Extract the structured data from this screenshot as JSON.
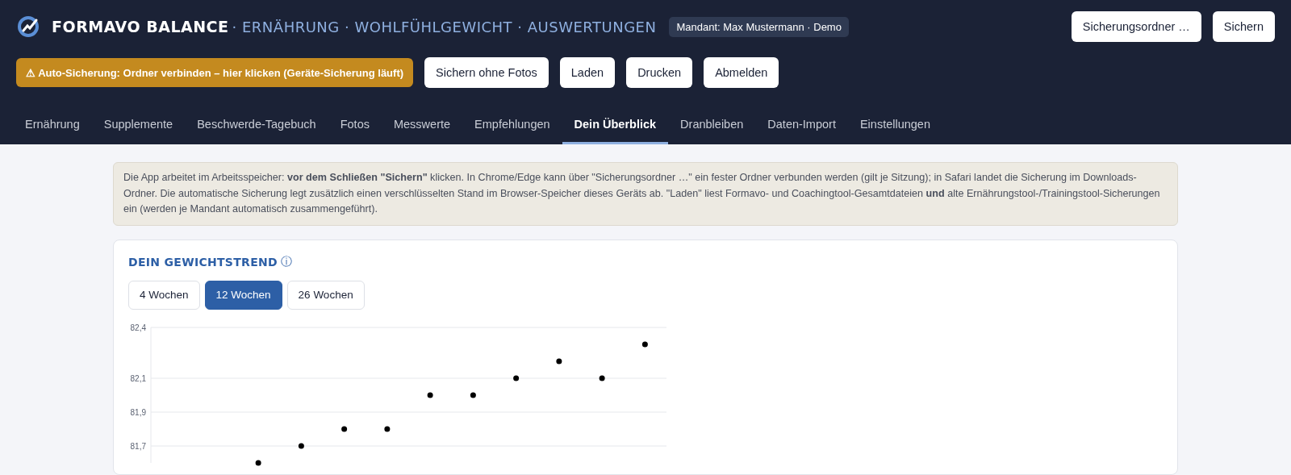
{
  "header": {
    "brand": "FORMAVO BALANCE",
    "subtitle": "· ERNÄHRUNG · WOHLFÜHLGEWICHT · AUSWERTUNGEN",
    "tenant": "Mandant: Max Mustermann · Demo",
    "top_buttons": [
      "Sicherungsordner …",
      "Sichern"
    ]
  },
  "toolbar": {
    "warning": "⚠ Auto-Sicherung: Ordner verbinden – hier klicken (Geräte-Sicherung läuft)",
    "buttons": [
      "Sichern ohne Fotos",
      "Laden",
      "Drucken",
      "Abmelden"
    ]
  },
  "tabs": [
    {
      "label": "Ernährung",
      "selected": false
    },
    {
      "label": "Supplemente",
      "selected": false
    },
    {
      "label": "Beschwerde-Tagebuch",
      "selected": false
    },
    {
      "label": "Fotos",
      "selected": false
    },
    {
      "label": "Messwerte",
      "selected": false
    },
    {
      "label": "Empfehlungen",
      "selected": false
    },
    {
      "label": "Dein Überblick",
      "selected": true
    },
    {
      "label": "Dranbleiben",
      "selected": false
    },
    {
      "label": "Daten-Import",
      "selected": false
    },
    {
      "label": "Einstellungen",
      "selected": false
    }
  ],
  "notice": "Die App arbeitet im Arbeitsspeicher: **vor dem Schließen \"Sichern\"** klicken. In Chrome/Edge kann über \"Sicherungsordner …\" ein fester Ordner verbunden werden (gilt je Sitzung); in Safari landet die Sicherung im Downloads-Ordner. Die automatische Sicherung legt zusätzlich einen verschlüsselten Stand im Browser-Speicher dieses Geräts ab. \"Laden\" liest Formavo- und Coachingtool-Gesamtdateien **und** alte Ernährungstool-/Trainingstool-Sicherungen ein (werden je Mandant automatisch zusammengeführt).",
  "trend": {
    "title": "DEIN GEWICHTSTREND",
    "info": "ⓘ",
    "ranges": [
      {
        "label": "4 Wochen",
        "selected": false
      },
      {
        "label": "12 Wochen",
        "selected": true
      },
      {
        "label": "26 Wochen",
        "selected": false
      }
    ],
    "chart_data": {
      "type": "scatter",
      "ylim": [
        81.6,
        82.4
      ],
      "grid": true,
      "series": [
        {
          "color": "#000000",
          "values": [
            null,
            null,
            81.6,
            81.7,
            81.8,
            81.8,
            82.0,
            82.0,
            82.1,
            82.2,
            82.1,
            82.3
          ]
        }
      ],
      "yticks": [
        {
          "value": 82.4,
          "label": "82,4"
        },
        {
          "value": 82.1,
          "label": "82,1"
        },
        {
          "value": 81.9,
          "label": "81,9"
        },
        {
          "value": 81.7,
          "label": "81,7"
        }
      ]
    }
  }
}
